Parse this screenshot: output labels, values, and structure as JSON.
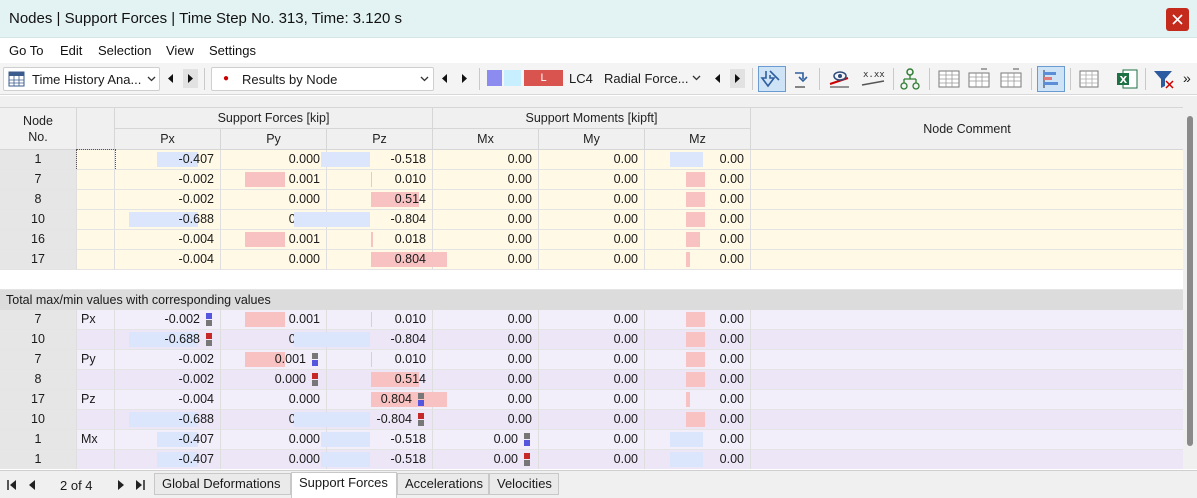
{
  "window": {
    "title": "Nodes | Support Forces | Time Step No. 313, Time: 3.120 s"
  },
  "menu": [
    "Go To",
    "Edit",
    "Selection",
    "View",
    "Settings"
  ],
  "toolbar": {
    "analysis_combo": "Time History Ana...",
    "results_combo": "Results by Node",
    "lc_badge": "L",
    "lc_label": "LC4",
    "lc_combo": "Radial Force...",
    "overflow": "»"
  },
  "table": {
    "group_forces": "Support Forces [kip]",
    "group_moments": "Support Moments [kipft]",
    "col_node": "Node No.",
    "col_px": "Px",
    "col_py": "Py",
    "col_pz": "Pz",
    "col_mx": "Mx",
    "col_my": "My",
    "col_mz": "Mz",
    "col_comment": "Node Comment",
    "rows": [
      {
        "node": "1",
        "px": "-0.407",
        "py": "0.000",
        "pz": "-0.518",
        "mx": "0.00",
        "my": "0.00",
        "mz": "0.00"
      },
      {
        "node": "7",
        "px": "-0.002",
        "py": "0.001",
        "pz": "0.010",
        "mx": "0.00",
        "my": "0.00",
        "mz": "0.00"
      },
      {
        "node": "8",
        "px": "-0.002",
        "py": "0.000",
        "pz": "0.514",
        "mx": "0.00",
        "my": "0.00",
        "mz": "0.00"
      },
      {
        "node": "10",
        "px": "-0.688",
        "py": "0.000",
        "pz": "-0.804",
        "mx": "0.00",
        "my": "0.00",
        "mz": "0.00"
      },
      {
        "node": "16",
        "px": "-0.004",
        "py": "0.001",
        "pz": "0.018",
        "mx": "0.00",
        "my": "0.00",
        "mz": "0.00"
      },
      {
        "node": "17",
        "px": "-0.004",
        "py": "0.000",
        "pz": "0.804",
        "mx": "0.00",
        "my": "0.00",
        "mz": "0.00"
      }
    ],
    "totals_label": "Total max/min values with corresponding values",
    "totals": [
      {
        "node": "7",
        "tag": "Px",
        "px": "-0.002",
        "py": "0.001",
        "pz": "0.010",
        "mx": "0.00",
        "my": "0.00",
        "mz": "0.00"
      },
      {
        "node": "10",
        "tag": "",
        "px": "-0.688",
        "py": "0.000",
        "pz": "-0.804",
        "mx": "0.00",
        "my": "0.00",
        "mz": "0.00"
      },
      {
        "node": "7",
        "tag": "Py",
        "px": "-0.002",
        "py": "0.001",
        "pz": "0.010",
        "mx": "0.00",
        "my": "0.00",
        "mz": "0.00"
      },
      {
        "node": "8",
        "tag": "",
        "px": "-0.002",
        "py": "0.000",
        "pz": "0.514",
        "mx": "0.00",
        "my": "0.00",
        "mz": "0.00"
      },
      {
        "node": "17",
        "tag": "Pz",
        "px": "-0.004",
        "py": "0.000",
        "pz": "0.804",
        "mx": "0.00",
        "my": "0.00",
        "mz": "0.00"
      },
      {
        "node": "10",
        "tag": "",
        "px": "-0.688",
        "py": "0.000",
        "pz": "-0.804",
        "mx": "0.00",
        "my": "0.00",
        "mz": "0.00"
      },
      {
        "node": "1",
        "tag": "Mx",
        "px": "-0.407",
        "py": "0.000",
        "pz": "-0.518",
        "mx": "0.00",
        "my": "0.00",
        "mz": "0.00"
      },
      {
        "node": "1",
        "tag": "",
        "px": "-0.407",
        "py": "0.000",
        "pz": "-0.518",
        "mx": "0.00",
        "my": "0.00",
        "mz": "0.00"
      }
    ]
  },
  "pager": {
    "text": "2 of 4"
  },
  "tabs": [
    "Global Deformations",
    "Support Forces",
    "Accelerations",
    "Velocities"
  ],
  "colors": {
    "accent_close": "#c42b1c",
    "pos_bar": "#f8c2c2",
    "neg_bar": "#dbe5fb",
    "row_main": "#fff9e6",
    "row_totals": "#f2eefa"
  }
}
